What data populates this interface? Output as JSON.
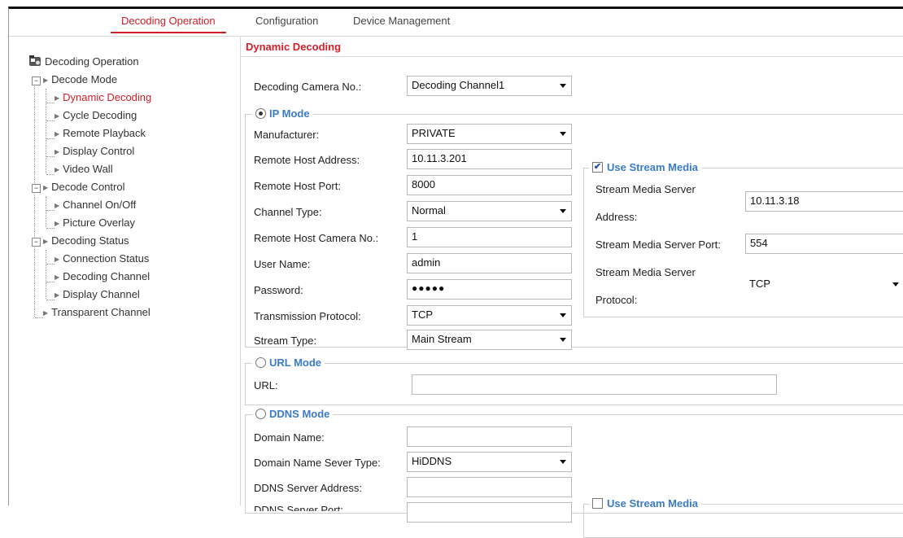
{
  "topnav": {
    "tabs": [
      {
        "label": "Decoding Operation",
        "active": true
      },
      {
        "label": "Configuration",
        "active": false
      },
      {
        "label": "Device Management",
        "active": false
      }
    ]
  },
  "sidebar": {
    "root": "Decoding Operation",
    "groups": [
      {
        "label": "Decode Mode",
        "items": [
          "Dynamic Decoding",
          "Cycle Decoding",
          "Remote Playback",
          "Display Control",
          "Video Wall"
        ]
      },
      {
        "label": "Decode Control",
        "items": [
          "Channel On/Off",
          "Picture Overlay"
        ]
      },
      {
        "label": "Decoding Status",
        "items": [
          "Connection Status",
          "Decoding Channel",
          "Display Channel"
        ]
      }
    ],
    "last": "Transparent Channel",
    "active_item": "Dynamic Decoding"
  },
  "main": {
    "title": "Dynamic Decoding",
    "camera_label": "Decoding Camera No.:",
    "camera_value": "Decoding Channel1",
    "ip_mode": {
      "legend": "IP Mode",
      "manufacturer_label": "Manufacturer:",
      "manufacturer_value": "PRIVATE",
      "host_label": "Remote Host Address:",
      "host_value": "10.11.3.201",
      "port_label": "Remote Host Port:",
      "port_value": "8000",
      "channel_type_label": "Channel Type:",
      "channel_type_value": "Normal",
      "camera_no_label": "Remote Host Camera No.:",
      "camera_no_value": "1",
      "user_label": "User Name:",
      "user_value": "admin",
      "password_label": "Password:",
      "password_value": "●●●●●",
      "protocol_label": "Transmission Protocol:",
      "protocol_value": "TCP",
      "stream_label": "Stream Type:",
      "stream_value": "Main Stream"
    },
    "stream_media": {
      "legend": "Use Stream Media",
      "checked": true,
      "server_address_label_1": "Stream Media Server",
      "server_address_label_2": "Address:",
      "server_address_value": "10.11.3.18",
      "server_port_label": "Stream Media Server Port:",
      "server_port_value": "554",
      "protocol_label_1": "Stream Media Server",
      "protocol_label_2": "Protocol:",
      "protocol_value": "TCP"
    },
    "url_mode": {
      "legend": "URL Mode",
      "url_label": "URL:",
      "url_value": ""
    },
    "ddns_mode": {
      "legend": "DDNS Mode",
      "domain_label": "Domain Name:",
      "domain_value": "",
      "type_label": "Domain Name Sever Type:",
      "type_value": "HiDDNS",
      "server_address_label": "DDNS Server Address:",
      "server_address_value": "",
      "server_port_label": "DDNS Server Port:",
      "server_port_value": ""
    },
    "stream_media_2": {
      "legend": "Use Stream Media",
      "checked": false
    }
  },
  "colors": {
    "accent_red": "#d0202a",
    "legend_blue": "#3a7bc8"
  }
}
